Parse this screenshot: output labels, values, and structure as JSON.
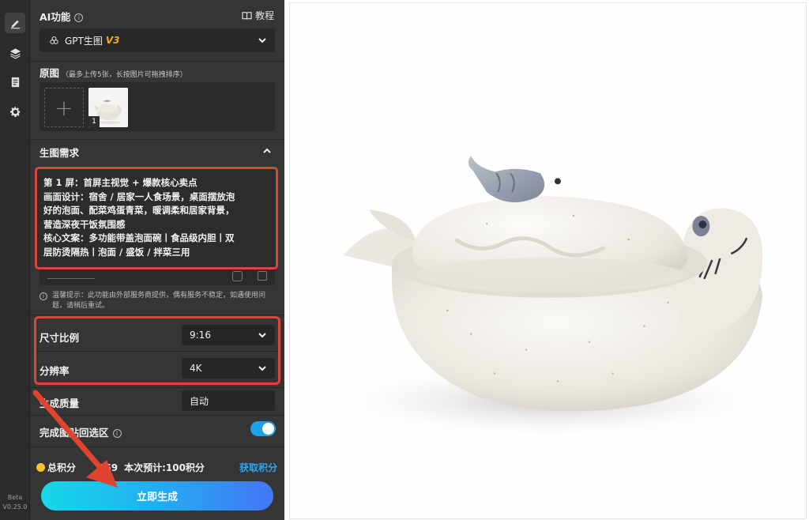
{
  "rail": {
    "items": [
      {
        "name": "edit",
        "icon": "pen-icon",
        "active": true
      },
      {
        "name": "layers",
        "icon": "layers-icon",
        "active": false
      },
      {
        "name": "notes",
        "icon": "clipboard-icon",
        "active": false
      },
      {
        "name": "settings",
        "icon": "gear-icon",
        "active": false
      }
    ],
    "version_line1": "Beta",
    "version_line2": "V0.25.0"
  },
  "ai": {
    "title": "AI功能",
    "tutorial_label": "教程",
    "model_name": "GPT生图",
    "model_version": "V3"
  },
  "source": {
    "title": "原图",
    "hint": "（最多上传5张，长按图片可拖拽排序）",
    "add_symbol": "+",
    "thumb_index": "1"
  },
  "requirements": {
    "title": "生图需求",
    "lines": [
      "第 1 屏：首屏主视觉 + 爆款核心卖点",
      "画面设计：宿舍 / 居家一人食场景，桌面摆放泡",
      "好的泡面、配菜鸡蛋青菜，暖调柔和居家背景，",
      "营造深夜干饭氛围感",
      "核心文案：多功能带盖泡面碗丨食品级内胆丨双",
      "层防烫隔热丨泡面 / 盛饭 / 拌菜三用"
    ],
    "notice": "温馨提示：此功能由外部服务商提供，偶有服务不稳定，如遇使用问题，请稍后重试。"
  },
  "settings": {
    "aspect_label": "尺寸比例",
    "aspect_value": "9:16",
    "resolution_label": "分辨率",
    "resolution_value": "4K",
    "quality_label": "生成质量",
    "quality_value": "自动",
    "paste_back_label": "完成图贴回选区",
    "paste_back_on": true
  },
  "footer": {
    "points_prefix": "总积分",
    "points_value": "369",
    "estimate": "本次预计:100积分",
    "get_points": "获取积分",
    "generate_label": "立即生成"
  },
  "colors": {
    "highlight": "#d9463a",
    "accent_blue": "#2aa7f5",
    "version_badge": "#f5a623"
  }
}
